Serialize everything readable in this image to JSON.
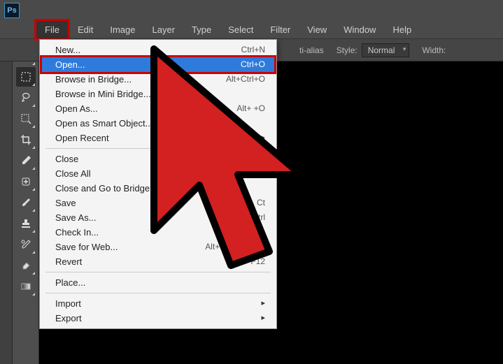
{
  "app": {
    "logo_text": "Ps"
  },
  "menubar": {
    "items": [
      {
        "label": "File",
        "highlighted": true
      },
      {
        "label": "Edit"
      },
      {
        "label": "Image"
      },
      {
        "label": "Layer"
      },
      {
        "label": "Type"
      },
      {
        "label": "Select"
      },
      {
        "label": "Filter"
      },
      {
        "label": "View"
      },
      {
        "label": "Window"
      },
      {
        "label": "Help"
      }
    ]
  },
  "optionsbar": {
    "antialias_label": "ti-alias",
    "style_label": "Style:",
    "style_value": "Normal",
    "width_label": "Width:"
  },
  "file_menu": {
    "items": [
      {
        "label": "New...",
        "shortcut": "Ctrl+N"
      },
      {
        "label": "Open...",
        "shortcut": "Ctrl+O",
        "highlighted": true
      },
      {
        "label": "Browse in Bridge...",
        "shortcut": "Alt+Ctrl+O"
      },
      {
        "label": "Browse in Mini Bridge..."
      },
      {
        "label": "Open As...",
        "shortcut": "Alt+            +O"
      },
      {
        "label": "Open as Smart Object..."
      },
      {
        "label": "Open Recent",
        "submenu": true
      },
      {
        "sep": true
      },
      {
        "label": "Close"
      },
      {
        "label": "Close All"
      },
      {
        "label": "Close and Go to Bridge..."
      },
      {
        "label": "Save",
        "shortcut": "Ct"
      },
      {
        "label": "Save As...",
        "shortcut": "ift+Ctrl"
      },
      {
        "label": "Check In..."
      },
      {
        "label": "Save for Web...",
        "shortcut": "Alt+Shift+Ctrl+S"
      },
      {
        "label": "Revert",
        "shortcut": "F12"
      },
      {
        "sep": true
      },
      {
        "label": "Place..."
      },
      {
        "sep": true
      },
      {
        "label": "Import",
        "submenu": true
      },
      {
        "label": "Export",
        "submenu": true
      }
    ]
  },
  "tools": [
    {
      "name": "move-tool"
    },
    {
      "name": "marquee-tool",
      "selected": true
    },
    {
      "name": "lasso-tool"
    },
    {
      "name": "magic-wand-tool"
    },
    {
      "name": "crop-tool"
    },
    {
      "name": "eyedropper-tool"
    },
    {
      "name": "healing-brush-tool"
    },
    {
      "name": "brush-tool"
    },
    {
      "name": "stamp-tool"
    },
    {
      "name": "history-brush-tool"
    },
    {
      "name": "eraser-tool"
    },
    {
      "name": "gradient-tool"
    }
  ]
}
